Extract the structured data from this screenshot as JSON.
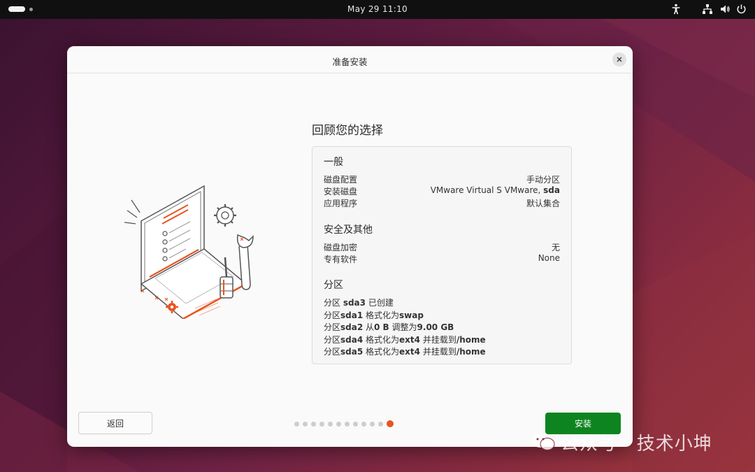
{
  "topbar": {
    "clock": "May 29  11:10"
  },
  "dialog": {
    "title": "准备安装",
    "heading": "回顾您的选择",
    "general": {
      "title": "一般",
      "rows": [
        {
          "key": "磁盘配置",
          "value": "手动分区"
        },
        {
          "key": "安装磁盘",
          "value_prefix": "VMware Virtual S VMware, ",
          "value_bold": "sda"
        },
        {
          "key": "应用程序",
          "value": "默认集合"
        }
      ]
    },
    "security": {
      "title": "安全及其他",
      "rows": [
        {
          "key": "磁盘加密",
          "value": "无"
        },
        {
          "key": "专有软件",
          "value": "None"
        }
      ]
    },
    "partitions": {
      "title": "分区",
      "lines": [
        [
          {
            "t": "分区 "
          },
          {
            "b": "sda3"
          },
          {
            "t": " 已创建"
          }
        ],
        [
          {
            "t": "分区"
          },
          {
            "b": "sda1"
          },
          {
            "t": " 格式化为"
          },
          {
            "b": "swap"
          }
        ],
        [
          {
            "t": "分区"
          },
          {
            "b": "sda2"
          },
          {
            "t": " 从"
          },
          {
            "b": "0 B"
          },
          {
            "t": " 调整为"
          },
          {
            "b": "9.00 GB"
          }
        ],
        [
          {
            "t": "分区"
          },
          {
            "b": "sda4"
          },
          {
            "t": " 格式化为"
          },
          {
            "b": "ext4"
          },
          {
            "t": " 并挂载到"
          },
          {
            "b": "/home"
          }
        ],
        [
          {
            "t": "分区"
          },
          {
            "b": "sda5"
          },
          {
            "t": " 格式化为"
          },
          {
            "b": "ext4"
          },
          {
            "t": " 并挂载到"
          },
          {
            "b": "/home"
          }
        ]
      ]
    },
    "back_label": "返回",
    "install_label": "安装",
    "progress": {
      "total": 12,
      "current": 12
    }
  },
  "watermark": {
    "text": "公众号 · 技术小坤"
  },
  "colors": {
    "accent": "#e95420",
    "install_green": "#0e8420"
  }
}
